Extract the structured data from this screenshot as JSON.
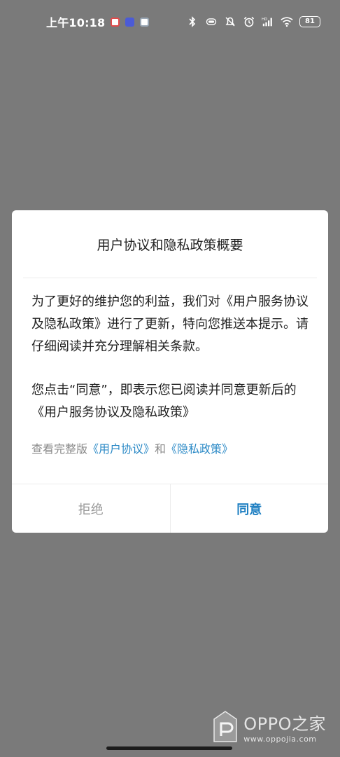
{
  "status_bar": {
    "time": "上午10:18",
    "battery": "81",
    "hd_label": "HD"
  },
  "dialog": {
    "title": "用户协议和隐私政策概要",
    "paragraph1": "为了更好的维护您的利益，我们对《用户服务协议及隐私政策》进行了更新，特向您推送本提示。请仔细阅读并充分理解相关条款。",
    "paragraph2": "您点击“同意”，即表示您已阅读并同意更新后的 《用户服务协议及隐私政策》",
    "links": {
      "prefix": "查看完整版",
      "user_agreement": "《用户协议》",
      "and": "和",
      "privacy_policy": "《隐私政策》"
    },
    "reject_label": "拒绝",
    "agree_label": "同意"
  },
  "watermark": {
    "brand": "OPPO之家",
    "url": "www.oppojia.com"
  },
  "colors": {
    "overlay": "#7a7a7a",
    "link": "#2a89c6",
    "agree": "#1e7fc2",
    "reject": "#9a9a9a"
  }
}
